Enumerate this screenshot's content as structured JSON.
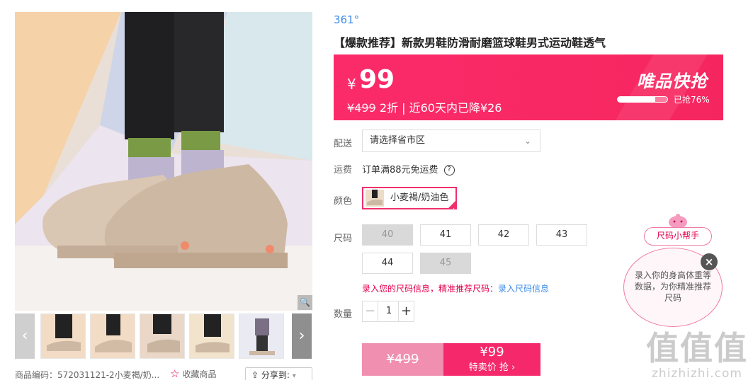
{
  "brand": "361°",
  "title": "【爆款推荐】新款男鞋防滑耐磨篮球鞋男式运动鞋透气",
  "promo": {
    "currency": "¥",
    "price": "99",
    "original_price": "¥499",
    "discount": "2折",
    "separator": "|",
    "price_drop": "近60天内已降¥26",
    "flash_title": "唯品快抢",
    "sold_text": "已抢76%",
    "sold_percent": 76
  },
  "delivery": {
    "label": "配送",
    "placeholder": "请选择省市区"
  },
  "shipping": {
    "label": "运费",
    "text": "订单满88元免运费",
    "help_icon": "?"
  },
  "color": {
    "label": "颜色",
    "selected": "小麦褐/奶油色"
  },
  "sizes": {
    "label": "尺码",
    "options": [
      {
        "value": "40",
        "available": false
      },
      {
        "value": "41",
        "available": true
      },
      {
        "value": "42",
        "available": true
      },
      {
        "value": "43",
        "available": true
      },
      {
        "value": "44",
        "available": true
      },
      {
        "value": "45",
        "available": false
      }
    ],
    "hint": "录入您的尺码信息，精准推荐尺码：",
    "hint_link": "录入尺码信息"
  },
  "quantity": {
    "label": "数量",
    "value": "1",
    "minus": "−",
    "plus": "+"
  },
  "buy": {
    "original_price": "¥499",
    "price": "¥99",
    "cta": "特卖价 抢 ›"
  },
  "size_helper": {
    "title": "尺码小帮手",
    "text": "录入你的身高体重等数据，为你精准推荐尺码",
    "close": "×"
  },
  "gallery": {
    "zoom_icon": "🔍",
    "prev": "‹",
    "next": "›",
    "sku_code": "商品编码：572031121-2小麦褐/奶...",
    "favorite": "收藏商品",
    "share": "分享到:",
    "share_caret": "▾"
  },
  "watermark": {
    "line1": "值值值",
    "line2": "zhizhizhi.com"
  },
  "colors": {
    "accent": "#f5286b",
    "link": "#3d8de8",
    "disabled": "#d9d9d9"
  }
}
